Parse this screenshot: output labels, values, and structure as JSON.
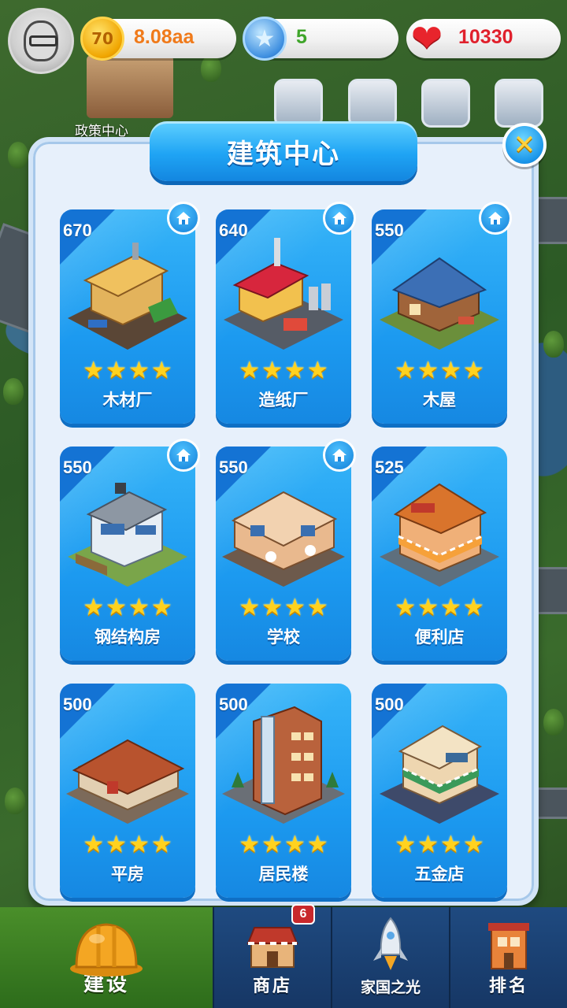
{
  "resources": {
    "coins": {
      "value": "8.08aa",
      "icon": "coin-icon",
      "icon_text": "70",
      "color": "#f07a1a"
    },
    "stars": {
      "value": "5",
      "icon": "blue-star-icon",
      "color": "#3fa52a"
    },
    "hearts": {
      "value": "10330",
      "icon": "heart-icon",
      "color": "#e0202c"
    }
  },
  "background": {
    "policy_center_label": "政策中心"
  },
  "modal": {
    "title": "建筑中心",
    "close_label": "✕",
    "cards": [
      {
        "cost": "670",
        "name": "木材厂",
        "stars": 4,
        "has_home_badge": true
      },
      {
        "cost": "640",
        "name": "造纸厂",
        "stars": 4,
        "has_home_badge": true
      },
      {
        "cost": "550",
        "name": "木屋",
        "stars": 4,
        "has_home_badge": true
      },
      {
        "cost": "550",
        "name": "钢结构房",
        "stars": 4,
        "has_home_badge": true
      },
      {
        "cost": "550",
        "name": "学校",
        "stars": 4,
        "has_home_badge": true
      },
      {
        "cost": "525",
        "name": "便利店",
        "stars": 4,
        "has_home_badge": false
      },
      {
        "cost": "500",
        "name": "平房",
        "stars": 4,
        "has_home_badge": false
      },
      {
        "cost": "500",
        "name": "居民楼",
        "stars": 4,
        "has_home_badge": false
      },
      {
        "cost": "500",
        "name": "五金店",
        "stars": 4,
        "has_home_badge": false
      }
    ]
  },
  "bottom_nav": {
    "items": [
      {
        "label": "建设",
        "icon": "hard-hat-icon",
        "active": true
      },
      {
        "label": "商店",
        "icon": "shop-icon",
        "active": false
      },
      {
        "label": "家国之光",
        "icon": "rocket-icon",
        "active": false
      },
      {
        "label": "排名",
        "icon": "ranking-tower-icon",
        "active": false
      }
    ],
    "shop_badge": "6"
  }
}
